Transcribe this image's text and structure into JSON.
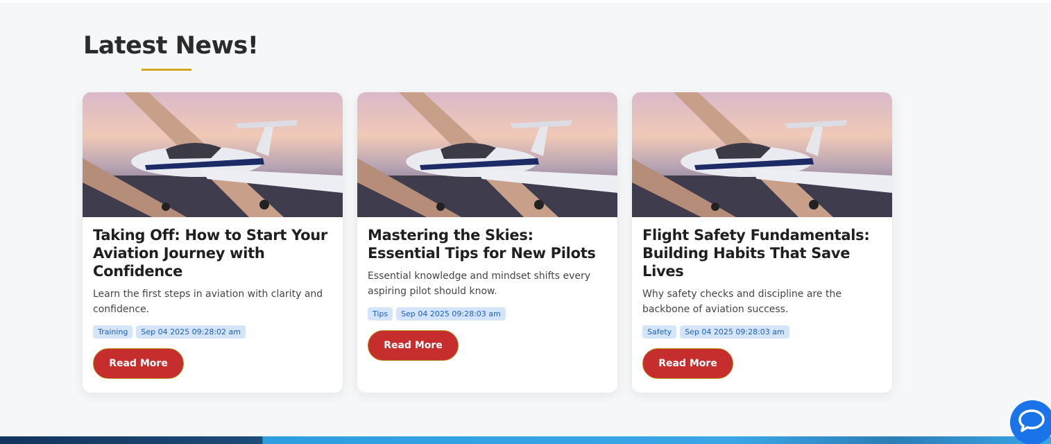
{
  "section": {
    "title": "Latest News!",
    "accent_color": "#d4a625"
  },
  "cards": [
    {
      "title": "Taking Off: How to Start Your Aviation Journey with Confidence",
      "description": "Learn the first steps in aviation with clarity and confidence.",
      "category": "Training",
      "date": "Sep 04 2025 09:28:02 am",
      "button_label": "Read More",
      "image_alt": "small white airplane flying at sunset"
    },
    {
      "title": "Mastering the Skies: Essential Tips for New Pilots",
      "description": "Essential knowledge and mindset shifts every aspiring pilot should know.",
      "category": "Tips",
      "date": "Sep 04 2025 09:28:03 am",
      "button_label": "Read More",
      "image_alt": "small white airplane flying at sunset"
    },
    {
      "title": "Flight Safety Fundamentals: Building Habits That Save Lives",
      "description": "Why safety checks and discipline are the backbone of aviation success.",
      "category": "Safety",
      "date": "Sep 04 2025 09:28:03 am",
      "button_label": "Read More",
      "image_alt": "small white airplane flying at sunset"
    }
  ],
  "colors": {
    "button": "#c62d2d",
    "tag_bg": "#d3e4fb",
    "tag_text": "#1c5fbd",
    "chat": "#1a73e8"
  },
  "chat": {
    "icon": "chat-bubble-icon"
  }
}
